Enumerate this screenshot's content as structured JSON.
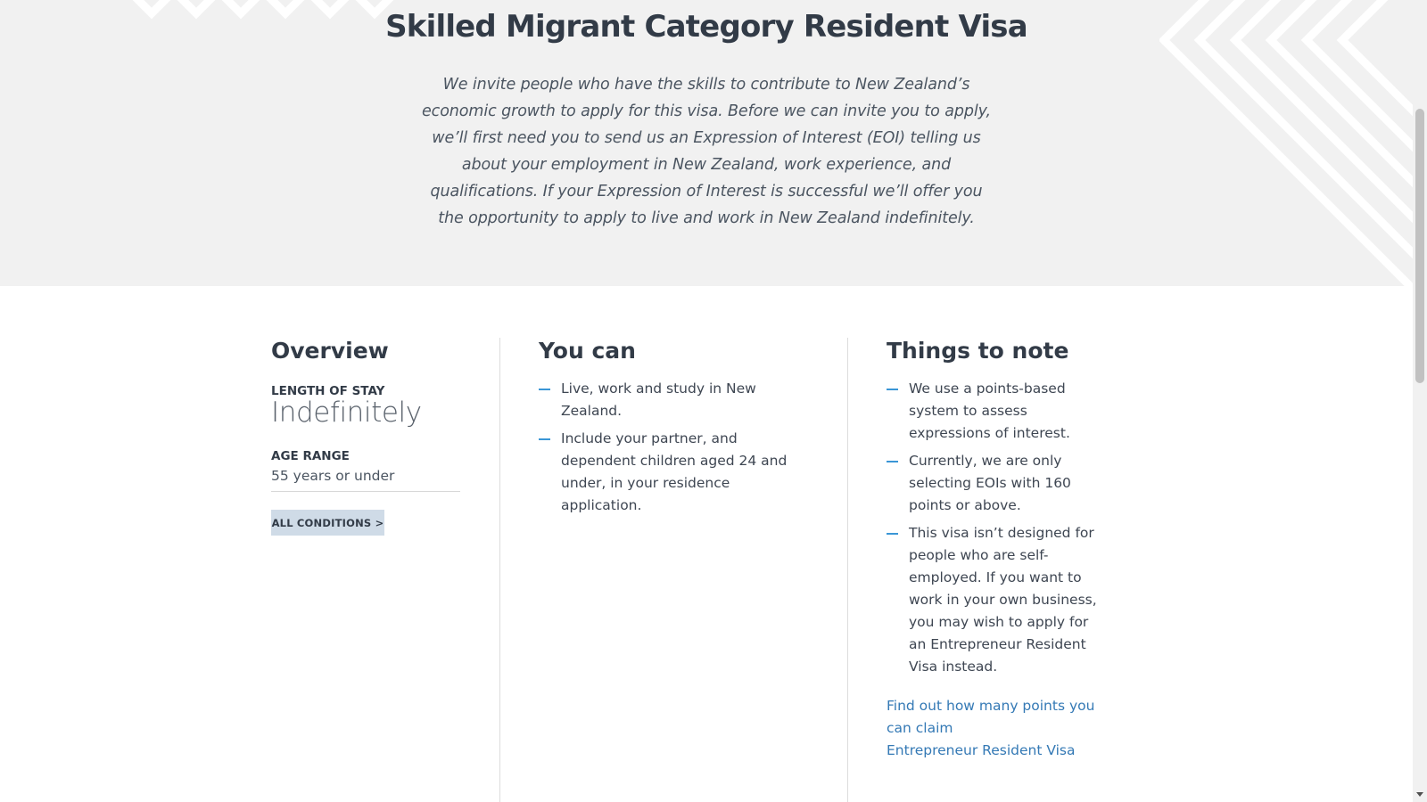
{
  "hero": {
    "title": "Skilled Migrant Category Resident Visa",
    "description": "We invite people who have the skills to contribute to New Zealand’s economic growth to apply for this visa. Before we can invite you to apply, we’ll first need you to send us an Expression of Interest (EOI) telling us about your employment in New Zealand, work experience, and qualifications. If your Expression of Interest is successful we’ll offer you the opportunity to apply to live and work in New Zealand indefinitely."
  },
  "overview": {
    "heading": "Overview",
    "length_label": "LENGTH OF STAY",
    "length_value": "Indefinitely",
    "age_label": "AGE RANGE",
    "age_value": "55 years or under",
    "conditions_button": "ALL CONDITIONS >"
  },
  "you_can": {
    "heading": "You can",
    "items": [
      "Live, work and study in New Zealand.",
      "Include your partner, and dependent children aged 24 and under, in your residence application."
    ]
  },
  "things_to_note": {
    "heading": "Things to note",
    "items": [
      "We use a points-based system to assess expressions of interest.",
      "Currently, we are only selecting EOIs with 160 points or above.",
      "This visa isn’t designed for people who are self-employed. If you want to work in your own business, you may wish to apply for an Entrepreneur Resident Visa instead."
    ],
    "links": [
      "Find out how many points you can claim",
      "Entrepreneur Resident Visa"
    ]
  },
  "colors": {
    "accent": "#3a96d6",
    "link": "#3479b5",
    "heading": "#323b47",
    "hero_background": "#f1f1f1",
    "button_background": "#cfdbe7"
  },
  "icons": {
    "list_bullet": "dash-icon",
    "scroll_down": "chevron-down-icon"
  }
}
